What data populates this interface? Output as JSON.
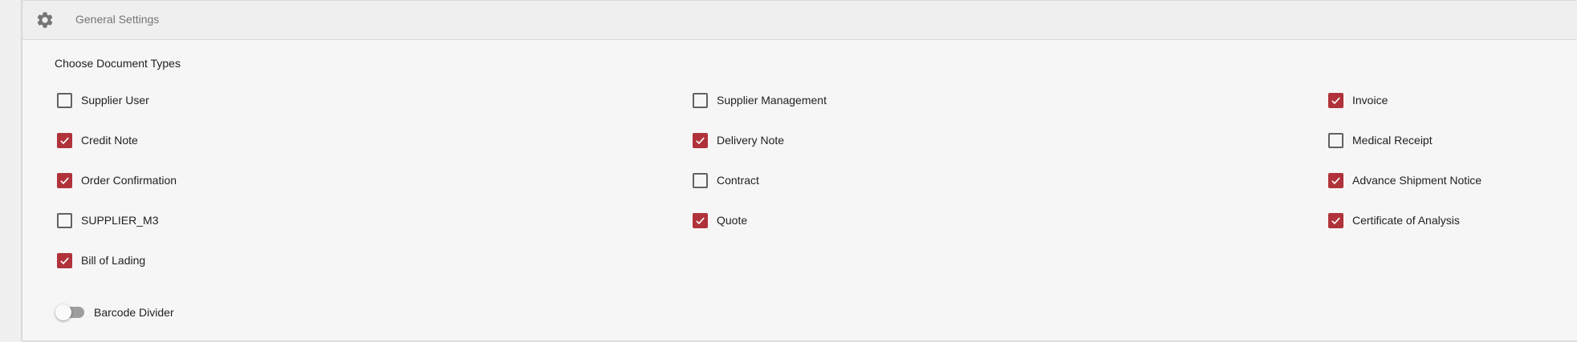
{
  "header": {
    "icon": "gear-icon",
    "title": "General Settings"
  },
  "section": {
    "title": "Choose Document Types"
  },
  "document_types": [
    {
      "label": "Supplier User",
      "checked": false
    },
    {
      "label": "Supplier Management",
      "checked": false
    },
    {
      "label": "Invoice",
      "checked": true
    },
    {
      "label": "Credit Note",
      "checked": true
    },
    {
      "label": "Delivery Note",
      "checked": true
    },
    {
      "label": "Medical Receipt",
      "checked": false
    },
    {
      "label": "Order Confirmation",
      "checked": true
    },
    {
      "label": "Contract",
      "checked": false
    },
    {
      "label": "Advance Shipment Notice",
      "checked": true
    },
    {
      "label": "SUPPLIER_M3",
      "checked": false
    },
    {
      "label": "Quote",
      "checked": true
    },
    {
      "label": "Certificate of Analysis",
      "checked": true
    },
    {
      "label": "Bill of Lading",
      "checked": true
    }
  ],
  "barcode_divider": {
    "label": "Barcode Divider",
    "enabled": false
  },
  "colors": {
    "accent": "#b0323a",
    "unchecked_border": "#616161",
    "panel_bg": "#f6f6f6",
    "header_bg": "#efefef",
    "muted_text": "#757575"
  }
}
